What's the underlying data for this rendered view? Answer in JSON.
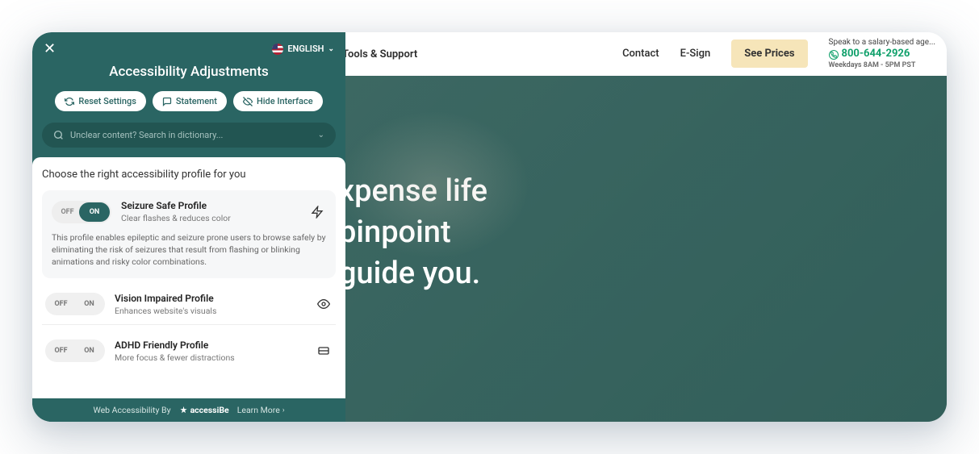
{
  "nav": {
    "tools": "Tools & Support",
    "contact": "Contact",
    "esign": "E-Sign",
    "seePrices": "See Prices",
    "phoneTop": "Speak to a salary-based age...",
    "phoneNum": "800-644-2926",
    "phoneHours": "Weekdays 8AM - 5PM PST"
  },
  "hero": {
    "line1": "xpense life",
    "line2": "pinpoint",
    "line3": " guide you."
  },
  "panel": {
    "language": "ENGLISH",
    "title": "Accessibility Adjustments",
    "reset": "Reset Settings",
    "statement": "Statement",
    "hide": "Hide Interface",
    "searchPlaceholder": "Unclear content? Search in dictionary...",
    "profilesHeading": "Choose the right accessibility profile for you",
    "toggle": {
      "off": "OFF",
      "on": "ON"
    },
    "profiles": [
      {
        "title": "Seizure Safe Profile",
        "sub": "Clear flashes & reduces color",
        "desc": "This profile enables epileptic and seizure prone users to browse safely by eliminating the risk of seizures that result from flashing or blinking animations and risky color combinations.",
        "active": true
      },
      {
        "title": "Vision Impaired Profile",
        "sub": "Enhances website's visuals",
        "active": false
      },
      {
        "title": "ADHD Friendly Profile",
        "sub": "More focus & fewer distractions",
        "active": false
      }
    ],
    "footerPrefix": "Web Accessibility By",
    "footerBrand": "accessiBe",
    "learnMore": "Learn More"
  }
}
